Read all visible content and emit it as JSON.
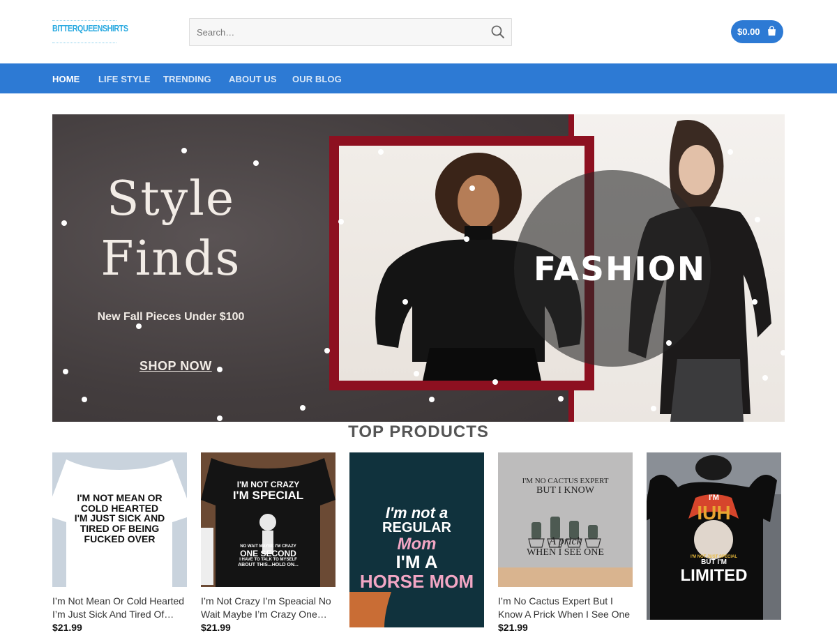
{
  "site": {
    "logo_text": "BITTERQUEENSHIRTS",
    "search_placeholder": "Search…",
    "cart_total": "$0.00"
  },
  "nav": {
    "items": [
      {
        "label": "HOME",
        "active": true
      },
      {
        "label": "LIFE STYLE",
        "active": false
      },
      {
        "label": "TRENDING",
        "active": false
      },
      {
        "label": "ABOUT US",
        "active": false
      },
      {
        "label": "OUR BLOG",
        "active": false
      }
    ]
  },
  "banner": {
    "headline_line1": "Style",
    "headline_line2": "Finds",
    "subline": "New Fall Pieces Under $100",
    "cta": "SHOP NOW",
    "overlay_text": "FASHION",
    "accent_color": "#8d1020"
  },
  "section": {
    "title": "TOP PRODUCTS"
  },
  "products": [
    {
      "name": "I’m Not Mean Or Cold Hearted I’m Just Sick And Tired Of Being Fucked Over",
      "price": "$21.99",
      "tee_color": "#ffffff",
      "print": [
        "I'M NOT MEAN OR",
        "COLD HEARTED",
        "I'M JUST SICK AND",
        "TIRED OF BEING",
        "FUCKED OVER"
      ]
    },
    {
      "name": "I’m Not Crazy I’m Speacial No Wait Maybe I’m Crazy One Second I Have To Talk To Myself",
      "price": "$21.99",
      "tee_color": "#141414",
      "print": [
        "I'M NOT CRAZY",
        "I'M SPECIAL",
        "NO WAIT MAYBE I'M CRAZY",
        "ONE SECOND",
        "I HAVE TO TALK TO MYSELF",
        "ABOUT THIS...HOLD ON..."
      ]
    },
    {
      "name": "",
      "price": "",
      "tee_color": "#10323d",
      "print": [
        "I'm not a",
        "REGULAR",
        "Mom",
        "I'M A",
        "HORSE MOM"
      ]
    },
    {
      "name": "I’m No Cactus Expert But I Know A Prick When I See One",
      "price": "$21.99",
      "tee_color": "#bdbcbc",
      "print": [
        "I'M NO CACTUS EXPERT",
        "BUT I KNOW",
        "A prick",
        "WHEN I SEE ONE"
      ]
    },
    {
      "name": "",
      "price": "",
      "tee_color": "#0d0d0d",
      "print": [
        "I'M",
        "IUH",
        "I'M NOT JUST SPECIAL",
        "BUT I'M",
        "LIMITED"
      ]
    }
  ],
  "colors": {
    "brand_blue": "#2d7ad4",
    "logo_blue": "#28a9e0"
  }
}
